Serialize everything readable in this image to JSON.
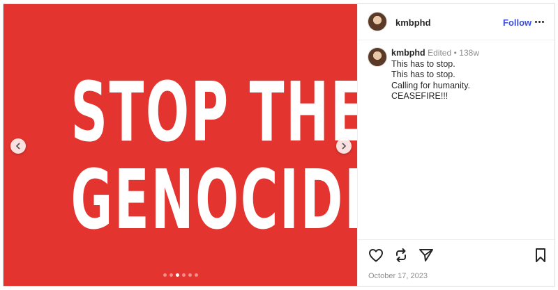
{
  "post": {
    "headline": [
      "STOP THE",
      "GENOCIDE"
    ],
    "dots": {
      "count": 6,
      "active_index": 2
    }
  },
  "header": {
    "username": "kmbphd",
    "follow_label": "Follow"
  },
  "caption": {
    "username": "kmbphd",
    "edited": "Edited",
    "separator": "•",
    "age": "138w",
    "lines": [
      "This has to stop.",
      "This has to stop.",
      "Calling for humanity.",
      "CEASEFIRE!!!"
    ]
  },
  "footer": {
    "date": "October 17, 2023"
  },
  "icons": {
    "prev": "chevron-left-icon",
    "next": "chevron-right-icon",
    "more": "more-horizontal-icon",
    "like": "heart-icon",
    "repost": "repost-icon",
    "share": "send-icon",
    "save": "bookmark-icon"
  },
  "colors": {
    "media_background": "#e3342f",
    "follow": "#3d4fcf",
    "muted": "#8e8e8e"
  }
}
